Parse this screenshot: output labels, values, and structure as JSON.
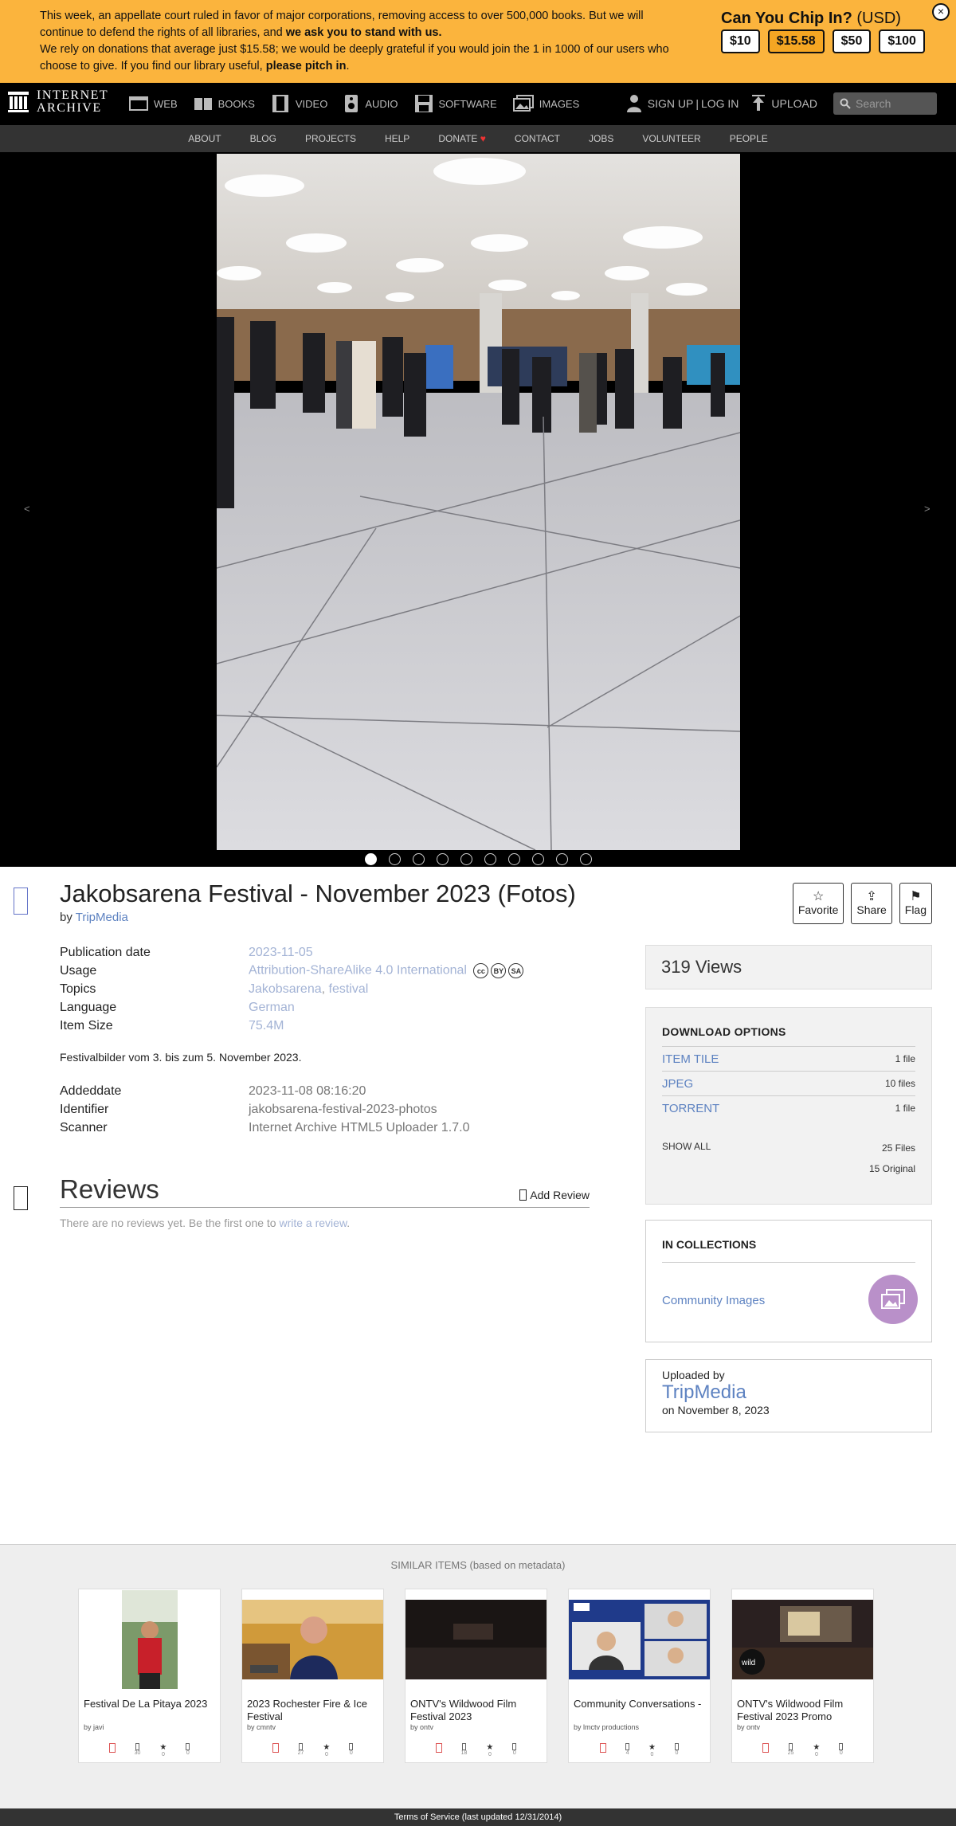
{
  "banner": {
    "line1a": "This week, an appellate court ruled in favor of major corporations, removing access to over 500,000 books. But we will continue to defend the rights of all libraries, and ",
    "line1b": "we ask you to stand with us.",
    "line2a": "We rely on donations that average just $15.58; we would be deeply grateful if you would join the 1 in 1000 of our users who choose to give. If you find our library useful, ",
    "line2b": "please pitch in",
    "line2c": ".",
    "chip_title": "Can You Chip In?",
    "currency": "(USD)",
    "amounts": [
      "$10",
      "$15.58",
      "$50",
      "$100"
    ],
    "selected_amount": "$15.58",
    "close": "×"
  },
  "nav": {
    "logo_line1": "INTERNET",
    "logo_line2": "ARCHIVE",
    "items": [
      "WEB",
      "BOOKS",
      "VIDEO",
      "AUDIO",
      "SOFTWARE",
      "IMAGES"
    ],
    "signup": "SIGN UP",
    "sep": "|",
    "login": "LOG IN",
    "upload": "UPLOAD",
    "search_placeholder": "Search"
  },
  "subnav": [
    "ABOUT",
    "BLOG",
    "PROJECTS",
    "HELP",
    "DONATE",
    "CONTACT",
    "JOBS",
    "VOLUNTEER",
    "PEOPLE"
  ],
  "viewer": {
    "prev": "<",
    "next": ">",
    "dot_count": 10,
    "active_dot": 1
  },
  "item": {
    "title": "Jakobsarena Festival - November 2023 (Fotos)",
    "by_label": "by",
    "author": "TripMedia",
    "actions": [
      {
        "icon": "☆",
        "label": "Favorite"
      },
      {
        "icon": "⇪",
        "label": "Share"
      },
      {
        "icon": "⚑",
        "label": "Flag"
      }
    ],
    "metadata": [
      {
        "key": "Publication date",
        "value": "2023-11-05"
      },
      {
        "key": "Usage",
        "value": "Attribution-ShareAlike 4.0 International"
      },
      {
        "key": "Topics",
        "value": "Jakobsarena",
        "value2": "festival"
      },
      {
        "key": "Language",
        "value": "German"
      },
      {
        "key": "Item Size",
        "value": "75.4M"
      }
    ],
    "cc_badges": [
      "cc",
      "BY",
      "SA"
    ],
    "description": "Festivalbilder vom 3. bis zum 5. November 2023.",
    "metadata2": [
      {
        "key": "Addeddate",
        "value": "2023-11-08 08:16:20"
      },
      {
        "key": "Identifier",
        "value": "jakobsarena-festival-2023-photos"
      },
      {
        "key": "Scanner",
        "value": "Internet Archive HTML5 Uploader 1.7.0"
      }
    ]
  },
  "reviews": {
    "heading": "Reviews",
    "add": "Add Review",
    "empty_text": "There are no reviews yet. Be the first one to ",
    "empty_link": "write a review",
    "empty_end": "."
  },
  "sidebar": {
    "views": "319 Views",
    "download_title": "DOWNLOAD OPTIONS",
    "downloads": [
      {
        "name": "ITEM TILE",
        "count": "1 file"
      },
      {
        "name": "JPEG",
        "count": "10 files"
      },
      {
        "name": "TORRENT",
        "count": "1 file"
      }
    ],
    "show_all": "SHOW ALL",
    "total_files": "25 Files",
    "original": "15 Original",
    "collections_title": "IN COLLECTIONS",
    "collection": "Community Images",
    "uploaded_by_label": "Uploaded by",
    "uploader": "TripMedia",
    "uploaded_on": "on November 8, 2023"
  },
  "similar": {
    "title": "SIMILAR ITEMS (based on metadata)",
    "items": [
      {
        "title": "Festival De La Pitaya 2023",
        "by": "by javi",
        "views": "30",
        "favs": "0",
        "reviews": "0",
        "thumb": "pitaya"
      },
      {
        "title": "2023 Rochester Fire & Ice Festival",
        "by": "by cmntv",
        "views": "27",
        "favs": "0",
        "reviews": "0",
        "thumb": "rochester"
      },
      {
        "title": "ONTV's Wildwood Film Festival 2023",
        "by": "by ontv",
        "views": "18",
        "favs": "0",
        "reviews": "0",
        "thumb": "dark"
      },
      {
        "title": "Community Conversations -",
        "by": "by lmctv productions",
        "views": "4",
        "favs": "0",
        "reviews": "0",
        "thumb": "conversations"
      },
      {
        "title": "ONTV's Wildwood Film Festival 2023 Promo",
        "by": "by ontv",
        "views": "25",
        "favs": "0",
        "reviews": "0",
        "thumb": "wildwood"
      }
    ]
  },
  "footer": "Terms of Service (last updated 12/31/2014)",
  "colors": {
    "banner": "#fbb43d",
    "link": "#5d82c1",
    "nav": "#000000",
    "subnav": "#333333"
  }
}
